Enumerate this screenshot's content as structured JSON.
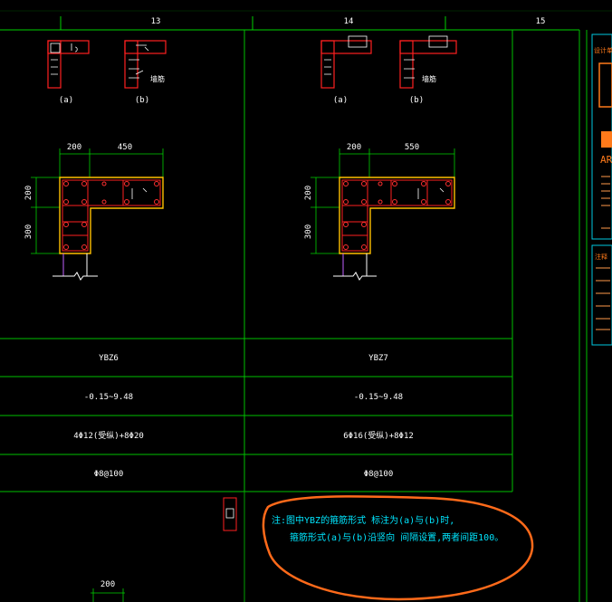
{
  "axes": [
    "13",
    "14",
    "15"
  ],
  "left_detail": {
    "sketch_a_label": "(a)",
    "sketch_b_label": "(b)",
    "sketch_b_note": "墙筋",
    "dim_top_1": "200",
    "dim_top_2": "450",
    "dim_left_1": "200",
    "dim_left_2": "300"
  },
  "right_detail": {
    "sketch_a_label": "(a)",
    "sketch_b_label": "(b)",
    "sketch_b_note": "墙筋",
    "dim_top_1": "200",
    "dim_top_2": "550",
    "dim_left_1": "200",
    "dim_left_2": "300"
  },
  "table": {
    "rows": [
      {
        "left": "YBZ6",
        "right": "YBZ7"
      },
      {
        "left": "-0.15~9.48",
        "right": "-0.15~9.48"
      },
      {
        "left": "4Φ12(受纵)+8Φ20",
        "right": "6Φ16(受纵)+8Φ12"
      },
      {
        "left": "Φ8@100",
        "right": "Φ8@100"
      }
    ]
  },
  "bottom_dim": "200",
  "note": {
    "line1": "注:图中YBZ的箍筋形式    标注为(a)与(b)时,",
    "line2": "箍筋形式(a)与(b)沿竖向      间隔设置,两者间距100。"
  },
  "title_block": {
    "header": "设计单位",
    "logo_text": "AR",
    "notes_header": "注释",
    "colors": {
      "frame": "#00c8e0",
      "accent": "#ff7a1a"
    }
  },
  "colors": {
    "grid": "#00d000",
    "rebar": "#ff2020",
    "concrete": "#ffc000",
    "table": "#00c000",
    "text": "#ffffff",
    "note": "#00e6ff",
    "annotation": "#ff6a1a"
  }
}
